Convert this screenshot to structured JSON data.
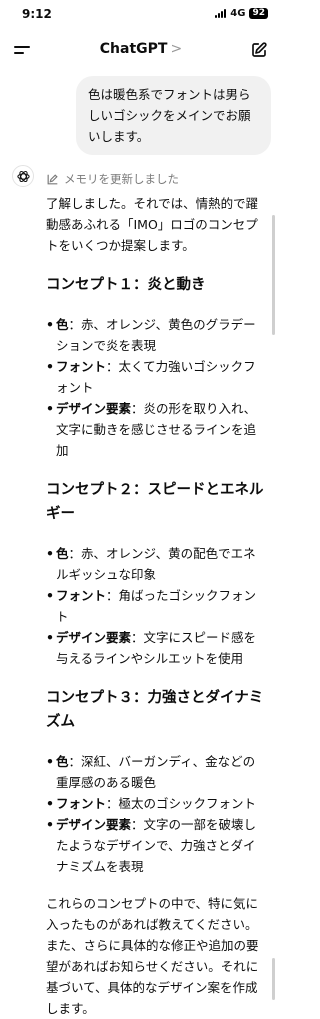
{
  "status": {
    "time": "9:12",
    "network": "4G",
    "battery": "92"
  },
  "nav": {
    "title": "ChatGPT",
    "chevron": ">"
  },
  "user_message": "色は暖色系でフォントは男らしいゴシックをメインでお願いします。",
  "memory_notice": "メモリを更新しました",
  "assistant": {
    "intro": "了解しました。それでは、情熱的で躍動感あふれる「IMO」ロゴのコンセプトをいくつか提案します。",
    "concepts": [
      {
        "title": "コンセプト１：炎と動き",
        "items": [
          {
            "label": "色",
            "text": "：赤、オレンジ、黄色のグラデーションで炎を表現"
          },
          {
            "label": "フォント",
            "text": "：太くて力強いゴシックフォント"
          },
          {
            "label": "デザイン要素",
            "text": "：炎の形を取り入れ、文字に動きを感じさせるラインを追加"
          }
        ]
      },
      {
        "title": "コンセプト２：スピードとエネルギー",
        "items": [
          {
            "label": "色",
            "text": "：赤、オレンジ、黄の配色でエネルギッシュな印象"
          },
          {
            "label": "フォント",
            "text": "：角ばったゴシックフォント"
          },
          {
            "label": "デザイン要素",
            "text": "：文字にスピード感を与えるラインやシルエットを使用"
          }
        ]
      },
      {
        "title": "コンセプト３：力強さとダイナミズム",
        "items": [
          {
            "label": "色",
            "text": "：深紅、バーガンディ、金などの重厚感のある暖色"
          },
          {
            "label": "フォント",
            "text": "：極太のゴシックフォント"
          },
          {
            "label": "デザイン要素",
            "text": "：文字の一部を破壊したようなデザインで、力強さとダイナミズムを表現"
          }
        ]
      }
    ],
    "closing": "これらのコンセプトの中で、特に気に入ったものがあれば教えてください。また、さらに具体的な修正や追加の要望があればお知らせください。それに基づいて、具体的なデザイン案を作成します。"
  },
  "icons": {
    "menu": "menu-icon",
    "edit": "new-chat-edit-icon",
    "assistant": "openai-logo-icon",
    "memory": "memory-pencil-icon"
  }
}
